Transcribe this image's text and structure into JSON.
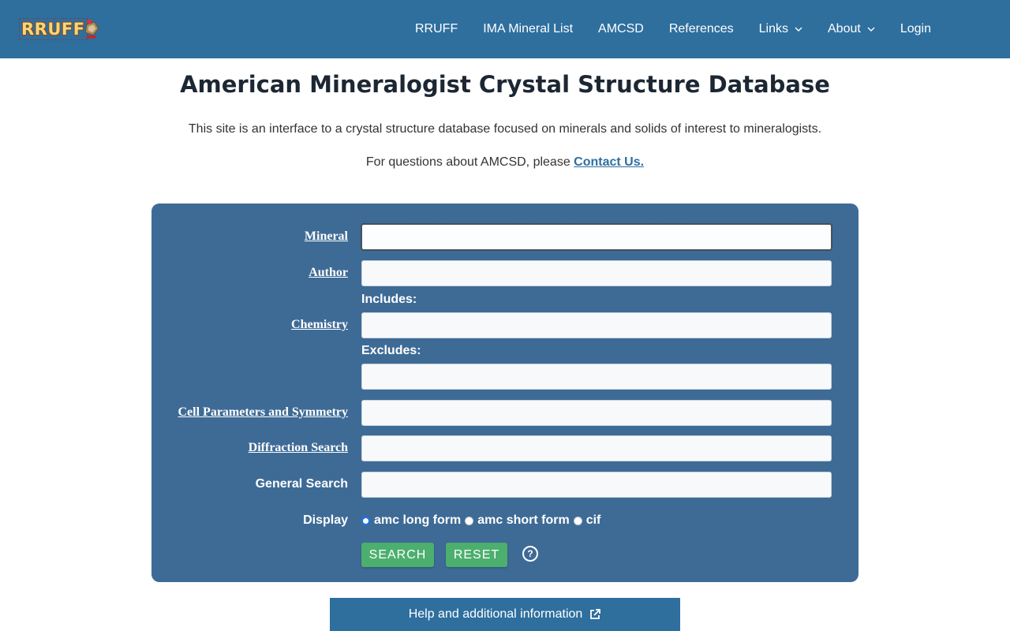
{
  "brand": {
    "logo_text": "RRUFF"
  },
  "nav": {
    "items": [
      {
        "label": "RRUFF",
        "dropdown": false
      },
      {
        "label": "IMA Mineral List",
        "dropdown": false
      },
      {
        "label": "AMCSD",
        "dropdown": false
      },
      {
        "label": "References",
        "dropdown": false
      },
      {
        "label": "Links",
        "dropdown": true
      },
      {
        "label": "About",
        "dropdown": true
      },
      {
        "label": "Login",
        "dropdown": false
      }
    ]
  },
  "header": {
    "title": "American Mineralogist Crystal Structure Database",
    "intro": "This site is an interface to a crystal structure database focused on minerals and solids of interest to mineralogists.",
    "contact_prefix": "For questions about AMCSD, please",
    "contact_link": "Contact Us."
  },
  "form": {
    "labels": {
      "mineral": "Mineral",
      "author": "Author",
      "chemistry": "Chemistry",
      "includes": "Includes:",
      "excludes": "Excludes:",
      "cell": "Cell Parameters and Symmetry",
      "diffraction": "Diffraction Search",
      "general": "General Search",
      "display": "Display"
    },
    "values": {
      "mineral": "",
      "author": "",
      "includes": "",
      "excludes": "",
      "cell": "",
      "diffraction": "",
      "general": ""
    },
    "display_options": [
      "amc long form",
      "amc short form",
      "cif"
    ],
    "display_selected": "amc long form",
    "search_button": "SEARCH",
    "reset_button": "RESET",
    "help_icon": "question-circle-icon"
  },
  "footer": {
    "help_label": "Help and additional information",
    "help_icon": "external-link-icon"
  },
  "colors": {
    "nav_bg": "#2e6f9e",
    "panel_bg": "#3e6b96",
    "button_bg": "#4caf6e",
    "link": "#2e6f9e"
  }
}
